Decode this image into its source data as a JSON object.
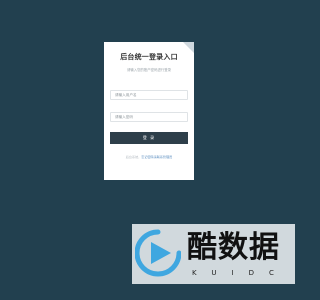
{
  "login": {
    "title": "后台统一登录入口",
    "subtitle": "请输入您的账户密码进行登录",
    "username_placeholder": "请输入用户名",
    "password_placeholder": "请输入密码",
    "login_button": "登 录",
    "footer_prefix": "后台系统，",
    "footer_link": "忘记密码请联系管理员"
  },
  "watermark": {
    "name": "酷数据",
    "letters": "KUIDC"
  },
  "colors": {
    "background": "#22404f",
    "button": "#2e3f4a",
    "card": "#ffffff"
  }
}
